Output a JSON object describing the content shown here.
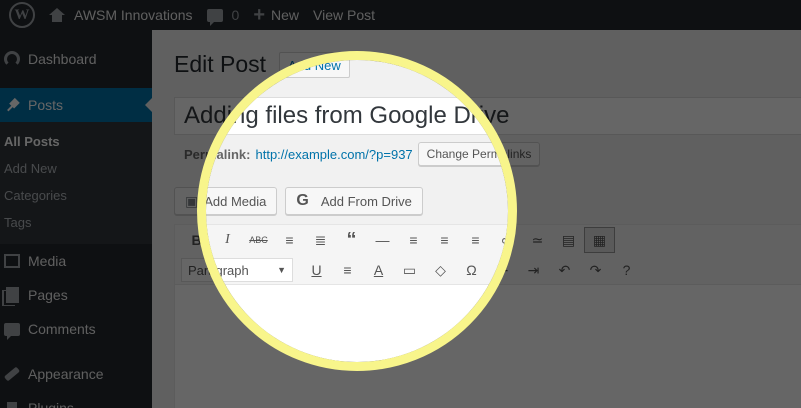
{
  "adminbar": {
    "site_name": "AWSM Innovations",
    "comments_count": "0",
    "new_label": "New",
    "view_post_label": "View Post"
  },
  "sidebar": {
    "items": [
      {
        "label": "Dashboard"
      },
      {
        "label": "Posts"
      },
      {
        "label": "Media"
      },
      {
        "label": "Pages"
      },
      {
        "label": "Comments"
      },
      {
        "label": "Appearance"
      },
      {
        "label": "Plugins"
      }
    ],
    "posts_submenu": [
      "All Posts",
      "Add New",
      "Categories",
      "Tags"
    ]
  },
  "main": {
    "page_title": "Edit Post",
    "add_new_label": "Add New",
    "post_title": "Adding files from Google Drive",
    "permalink_label": "Permalink:",
    "permalink_url": "http://example.com/?p=937",
    "change_permalinks_label": "Change Permalinks",
    "add_media_label": "Add Media",
    "add_from_drive_label": "Add From Drive",
    "format_select_value": "Paragraph"
  },
  "colors": {
    "admin_dark": "#23282d",
    "accent_blue": "#0073aa",
    "highlight_ring": "#f8f58b"
  },
  "icons": [
    "wordpress-logo-icon",
    "home-icon",
    "comment-icon",
    "plus-icon",
    "dashboard-icon",
    "pushpin-icon",
    "media-icon",
    "pages-icon",
    "comments-icon",
    "appearance-icon",
    "plugins-icon",
    "google-g-icon"
  ]
}
